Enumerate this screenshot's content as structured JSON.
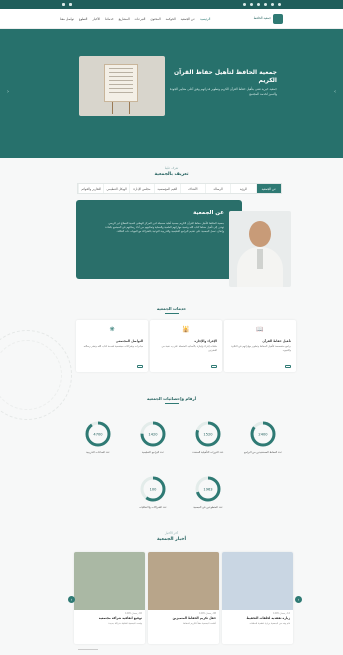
{
  "topbar": {
    "socials": [
      "twitter-icon",
      "facebook-icon",
      "youtube-icon",
      "instagram-icon",
      "snapchat-icon",
      "whatsapp-icon"
    ]
  },
  "nav": {
    "logo_text": "جمعية الحافظ",
    "menu": [
      "الرئيسية",
      "عن الجمعية",
      "الحوكمة",
      "المحتوى",
      "التبرعات",
      "المشاريع",
      "خدماتنا",
      "الأخبار",
      "التطوع",
      "تواصل معنا"
    ]
  },
  "hero": {
    "title": "جمعية الحافظ لتأهيل حفاظ القرآن الكريم",
    "description": "جمعية خيرية تعنى بتأهيل حفاظ القرآن الكريم وتطوير قدراتهم وفق أعلى معايير الجودة والتميز لخدمة المجتمع"
  },
  "about": {
    "subtitle": "تعرف علينا",
    "title": "تعريف بالجمعية",
    "tabs": [
      "عن الجمعية",
      "الرؤية",
      "الرسالة",
      "الأهداف",
      "القيم المؤسسية",
      "مجلس الإدارة",
      "الهيكل التنظيمي",
      "التقارير والقوائم"
    ],
    "card_title": "عن الجمعية",
    "card_text": "جمعية الحافظ لتأهيل حفاظ القرآن الكريم جمعية أهلية مسجلة لدى المركز الوطني لتنمية القطاع غير الربحي تهدف إلى تأهيل حفاظ كتاب الله وتنمية مهاراتهم العلمية والعملية وتمكينهم من أداء رسالتهم في المجتمع بكفاءة وإتقان. تعمل الجمعية على تقديم البرامج التعليمية والتدريبية النوعية بالشراكة مع الجهات ذات العلاقة."
  },
  "services": {
    "title": "خدمات الجمعية",
    "items": [
      {
        "icon": "book-icon",
        "title": "تأهيل حفاظ القرآن",
        "desc": "برامج متخصصة لتأهيل الحفاظ وتطوير مهاراتهم في التلاوة والتجويد"
      },
      {
        "icon": "mosque-icon",
        "title": "الإقراء والإجازة",
        "desc": "حلقات إقراء وإجازة بالأسانيد المتصلة على يد نخبة من المقرئين"
      },
      {
        "icon": "network-icon",
        "title": "التواصل المجتمعي",
        "desc": "مبادرات وشراكات مجتمعية لخدمة كتاب الله ونشر رسالته"
      }
    ]
  },
  "stats": {
    "title": "أرقام وإحصائيات الجمعية",
    "items": [
      {
        "value": "2400",
        "label": "عدد الحفاظ المستفيدين من البرامج",
        "fraction": 0.85
      },
      {
        "value": "1520",
        "label": "عدد الدورات التأهيلية المنفذة",
        "fraction": 0.8
      },
      {
        "value": "1420",
        "label": "عدد البرامج التعليمية",
        "fraction": 0.75
      },
      {
        "value": "4700",
        "label": "عدد الساعات التدريبية",
        "fraction": 0.9
      },
      {
        "value": "1963",
        "label": "عدد المتطوعين في الجمعية",
        "fraction": 0.7
      },
      {
        "value": "100",
        "label": "عدد الشراكات والاتفاقيات",
        "fraction": 0.6
      },
      {
        "value": "2000",
        "label": "عدد الأنشطة والفعاليات",
        "fraction": 0.65
      }
    ]
  },
  "news": {
    "subtitle": "آخر الأخبار",
    "title": "أخبار الجمعية",
    "items": [
      {
        "date": "12 رمضان 1445",
        "title": "زيارة تفقدية لحلقات التحفيظ",
        "desc": "قام وفد من الجمعية بزيارة تفقدية للحلقات",
        "color": "#c9d6e3"
      },
      {
        "date": "08 رمضان 1445",
        "title": "حفل تكريم الحفاظ المتميزين",
        "desc": "أقامت الجمعية حفلاً لتكريم الحفاظ",
        "color": "#b8a58a"
      },
      {
        "date": "02 رمضان 1445",
        "title": "توقيع اتفاقية شراكة مجتمعية",
        "desc": "وقعت الجمعية اتفاقية شراكة جديدة",
        "color": "#aab8a4"
      }
    ]
  },
  "colors": {
    "primary": "#2a6f6a",
    "dark": "#1f5e5b",
    "accent": "#2f7a74"
  }
}
